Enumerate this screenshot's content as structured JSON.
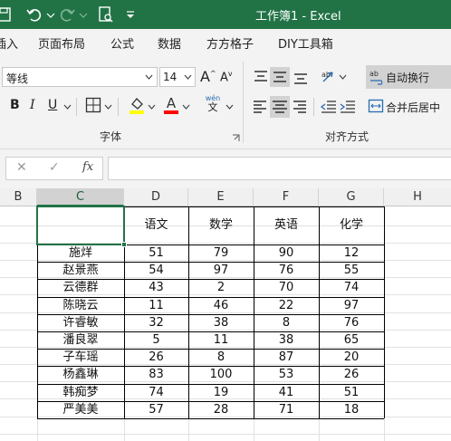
{
  "titlebar": {
    "title": "工作簿1 - Excel",
    "icons": [
      "save-icon",
      "undo-icon",
      "undo-dropdown-icon",
      "redo-icon",
      "redo-dropdown-icon",
      "print-preview-icon",
      "customize-qat-icon"
    ],
    "bg": "#217346"
  },
  "menu": {
    "items": [
      "插入",
      "页面布局",
      "公式",
      "数据",
      "方方格子",
      "DIY工具箱"
    ],
    "first_visible": "插入"
  },
  "font": {
    "name": "等线",
    "size": "14",
    "grow": "A",
    "shrink": "A",
    "bold": "B",
    "italic": "I",
    "underline": "U",
    "fill_color": "#ffff00",
    "font_color": "#ff0000",
    "phonetic_top": "wén",
    "phonetic_bottom": "文",
    "group_label": "字体"
  },
  "alignment": {
    "wrap_text": "自动换行",
    "merge_center": "合并后居中",
    "group_label": "对齐方式"
  },
  "formula_bar": {
    "cancel": "✕",
    "confirm": "✓",
    "fx": "fx",
    "content": ""
  },
  "grid": {
    "columns": [
      "B",
      "C",
      "D",
      "E",
      "F",
      "G",
      "H"
    ],
    "selected_column": "C",
    "header": [
      "",
      "语文",
      "数学",
      "英语",
      "化学"
    ],
    "rows": [
      [
        "施烊",
        "51",
        "79",
        "90",
        "12"
      ],
      [
        "赵景燕",
        "54",
        "97",
        "76",
        "55"
      ],
      [
        "云德群",
        "43",
        "2",
        "70",
        "74"
      ],
      [
        "陈晓云",
        "11",
        "46",
        "22",
        "97"
      ],
      [
        "许睿敏",
        "32",
        "38",
        "8",
        "76"
      ],
      [
        "潘良翠",
        "5",
        "11",
        "38",
        "65"
      ],
      [
        "子车瑶",
        "26",
        "8",
        "87",
        "20"
      ],
      [
        "杨鑫琳",
        "83",
        "100",
        "53",
        "26"
      ],
      [
        "韩痴梦",
        "74",
        "19",
        "41",
        "51"
      ],
      [
        "严美美",
        "57",
        "28",
        "71",
        "18"
      ]
    ]
  }
}
